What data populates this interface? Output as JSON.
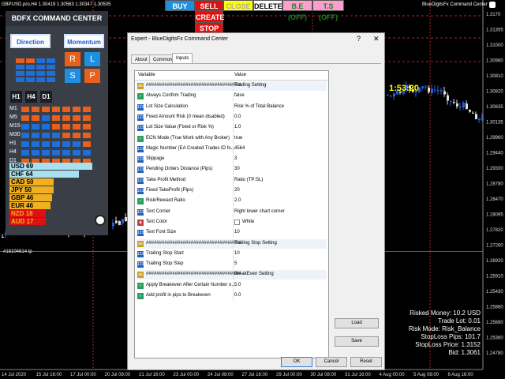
{
  "chart": {
    "symbol_info": "GBPUSD.pro,H4  1.30419  1.30563  1.30347  1.30505",
    "ea_name": "BlueDigitsFx Command Center",
    "countdown": "1:53:20",
    "indicator_label": "#18104814 tp",
    "price_labels": [
      "1.3170",
      "1.31355",
      "1.31000",
      "1.30980",
      "1.30810",
      "1.30820",
      "1.30635",
      "1.30135",
      "1.29960",
      "1.29440",
      "1.29330",
      "1.28780",
      "1.28470",
      "1.28095",
      "1.27820",
      "1.27260",
      "1.26920",
      "1.25910",
      "1.25430",
      "1.25880",
      "1.25690",
      "1.25360",
      "1.24780"
    ],
    "date_labels": [
      "14 Jul 2020",
      "15 Jul 16:00",
      "17 Jul 00:00",
      "20 Jul 08:00",
      "21 Jul 16:00",
      "23 Jul 00:00",
      "24 Jul 08:00",
      "27 Jul 16:00",
      "29 Jul 00:00",
      "30 Jul 08:00",
      "31 Jul 16:00",
      "4 Aug 00:00",
      "5 Aug 08:00",
      "6 Aug 16:00"
    ]
  },
  "trade_buttons": {
    "buy": "BUY",
    "sell": "SELL",
    "close": "CLOSE",
    "delete": "DELETE",
    "be": "B.E (OFF)",
    "ts": "T.S (OFF)",
    "create": "CREATE",
    "stop": "STOP"
  },
  "panel": {
    "title": "BDFX COMMAND CENTER",
    "direction": "Direction",
    "momentum": "Momentum",
    "mom_buttons": [
      "R",
      "L",
      "S",
      "P"
    ],
    "mom_colors": [
      "#e8601c",
      "#1e8fe0",
      "#1e8fe0",
      "#e8601c"
    ],
    "timeframes": [
      "H1",
      "H4",
      "D1"
    ],
    "tf_rows": [
      {
        "label": "M1",
        "cells": [
          "o",
          "o",
          "o",
          "o",
          "o",
          "o",
          "o"
        ]
      },
      {
        "label": "M5",
        "cells": [
          "o",
          "o",
          "b",
          "o",
          "o",
          "o",
          "o"
        ]
      },
      {
        "label": "M15",
        "cells": [
          "b",
          "b",
          "b",
          "o",
          "o",
          "o",
          "o"
        ]
      },
      {
        "label": "M30",
        "cells": [
          "b",
          "b",
          "b",
          "b",
          "o",
          "o",
          "o"
        ]
      },
      {
        "label": "H1",
        "cells": [
          "b",
          "b",
          "b",
          "b",
          "b",
          "b",
          "o"
        ]
      },
      {
        "label": "H4",
        "cells": [
          "b",
          "b",
          "b",
          "b",
          "b",
          "b",
          "b"
        ]
      },
      {
        "label": "D1",
        "cells": [
          "o",
          "o",
          "o",
          "o",
          "o",
          "o",
          "o"
        ]
      }
    ],
    "currencies": [
      {
        "name": "USD",
        "value": "69",
        "color": "#a8e0f0",
        "text": "#000"
      },
      {
        "name": "CHF",
        "value": "64",
        "color": "#a8e0f0",
        "text": "#000"
      },
      {
        "name": "CAD",
        "value": "50",
        "color": "#f0b020",
        "text": "#000"
      },
      {
        "name": "JPY",
        "value": "50",
        "color": "#f0b020",
        "text": "#000"
      },
      {
        "name": "GBP",
        "value": "46",
        "color": "#f0b020",
        "text": "#000"
      },
      {
        "name": "EUR",
        "value": "46",
        "color": "#f0b020",
        "text": "#000"
      },
      {
        "name": "NZD",
        "value": "18",
        "color": "#e01010",
        "text": "#f0b020"
      },
      {
        "name": "AUD",
        "value": "17",
        "color": "#e01010",
        "text": "#f0b020"
      }
    ]
  },
  "dialog": {
    "title": "Expert - BlueDigitsFx Command Center",
    "help": "?",
    "close": "✕",
    "tabs": [
      "About",
      "Common",
      "Inputs"
    ],
    "col_variable": "Variable",
    "col_value": "Value",
    "params": [
      {
        "name": "####################################",
        "value": "Trading Setting",
        "icon": "ab"
      },
      {
        "name": "Always Confirm Trading",
        "value": "false",
        "icon": "bool"
      },
      {
        "name": "Lot Size Calculation",
        "value": "Risk % of Total Balance",
        "icon": "num"
      },
      {
        "name": "Fixed Amount Risk (0 mean disabled)",
        "value": "0.0",
        "icon": "num"
      },
      {
        "name": "Lot Size Value (Fixed or Risk %)",
        "value": "1.0",
        "icon": "num"
      },
      {
        "name": "ECN Mode (True Work with Any Broker)",
        "value": "true",
        "icon": "bool"
      },
      {
        "name": "Magic Number (EA Created Trades ID fo...",
        "value": "4564",
        "icon": "num"
      },
      {
        "name": "Slippage",
        "value": "3",
        "icon": "num"
      },
      {
        "name": "Pending Orders Distance (Pips)",
        "value": "30",
        "icon": "num"
      },
      {
        "name": "Take Profit Method",
        "value": "Ratio (TP:SL)",
        "icon": "num"
      },
      {
        "name": "Fixed TakeProfit (Pips)",
        "value": "20",
        "icon": "num"
      },
      {
        "name": "Risk/Reward Ratio",
        "value": "2.0",
        "icon": "bool"
      },
      {
        "name": "Text Corner",
        "value": "Right lower chart corner",
        "icon": "num"
      },
      {
        "name": "Text Color",
        "value": "White",
        "icon": "color"
      },
      {
        "name": "Text Font Size",
        "value": "10",
        "icon": "num"
      },
      {
        "name": "####################################",
        "value": "Trailing Stop Setting",
        "icon": "ab"
      },
      {
        "name": "Trailing Stop Start",
        "value": "10",
        "icon": "num"
      },
      {
        "name": "Trailing Stop Step",
        "value": "5",
        "icon": "num"
      },
      {
        "name": "####################################",
        "value": "BreakEven Setting",
        "icon": "ab"
      },
      {
        "name": "Apply Breakeven After Certain Number o...",
        "value": "5.0",
        "icon": "bool"
      },
      {
        "name": "Add profit in pips to Breakeven",
        "value": "0.0",
        "icon": "bool"
      }
    ],
    "load": "Load",
    "save": "Save",
    "ok": "OK",
    "cancel": "Cancel",
    "reset": "Reset"
  },
  "risk_info": [
    "Risked Money: 10.2 USD",
    "Trade Lot: 0.01",
    "Risk Mode: Risk_Balance",
    "StopLoss Pips: 101.7",
    "StopLoss Price: 1.3152",
    "Bid: 1.3061"
  ]
}
